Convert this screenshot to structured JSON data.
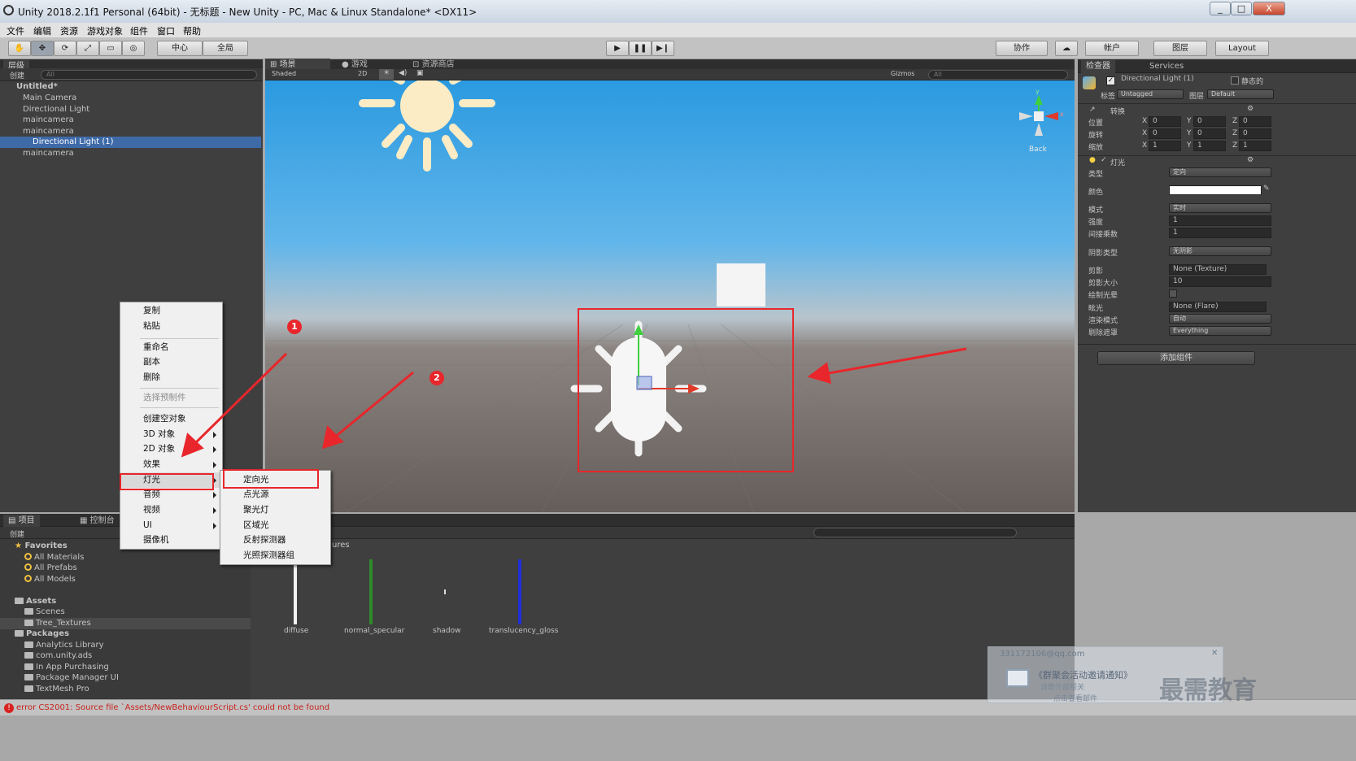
{
  "window": {
    "title": "Unity 2018.2.1f1 Personal (64bit) - 无标题 - New Unity - PC, Mac & Linux Standalone* <DX11>",
    "controls": [
      "_",
      "□",
      "X"
    ]
  },
  "menu": [
    "文件",
    "编辑",
    "资源",
    "游戏对象",
    "组件",
    "窗口",
    "帮助"
  ],
  "toolbar": {
    "pivot": "中心",
    "space": "全局",
    "collab": "协作",
    "account": "帐户",
    "layers": "图层",
    "layout": "Layout"
  },
  "hierarchy": {
    "tab": "层级",
    "create": "创建",
    "search_placeholder": "All",
    "scene_name": "Untitled*",
    "items": [
      "Main Camera",
      "Directional Light",
      "maincamera",
      "maincamera",
      "Directional Light (1)",
      "maincamera"
    ]
  },
  "scene_view": {
    "tabs": [
      "场景",
      "游戏",
      "资源商店"
    ],
    "shading": "Shaded",
    "mode_2d": "2D",
    "gizmos": "Gizmos",
    "search_placeholder": "All",
    "gizmo": {
      "y": "y",
      "x": "x",
      "back": "Back"
    }
  },
  "inspector": {
    "tabs": [
      "检查器",
      "Services"
    ],
    "object_name": "Directional Light (1)",
    "static_label": "静态的",
    "tag_label": "标签",
    "tag_value": "Untagged",
    "layer_label": "图层",
    "layer_value": "Default",
    "transform": {
      "title": "转换",
      "rows": [
        {
          "label": "位置",
          "x": "0",
          "y": "0",
          "z": "0"
        },
        {
          "label": "旋转",
          "x": "0",
          "y": "0",
          "z": "0"
        },
        {
          "label": "缩放",
          "x": "1",
          "y": "1",
          "z": "1"
        }
      ]
    },
    "light": {
      "title": "灯光",
      "type_label": "类型",
      "type_value": "定向",
      "color_label": "颜色",
      "mode_label": "模式",
      "mode_value": "实时",
      "intensity_label": "强度",
      "intensity_value": "1",
      "indirect_label": "间接乘数",
      "indirect_value": "1",
      "shadow_label": "阴影类型",
      "shadow_value": "无阴影",
      "cookie_label": "剪影",
      "cookie_value": "None (Texture)",
      "cookie_size_label": "剪影大小",
      "cookie_size_value": "10",
      "halo_label": "绘制光晕",
      "flare_label": "眩光",
      "flare_value": "None (Flare)",
      "render_mode_label": "渲染模式",
      "render_mode_value": "自动",
      "culling_label": "剔除遮罩",
      "culling_value": "Everything"
    },
    "add_component": "添加组件"
  },
  "project": {
    "tabs": [
      "项目",
      "控制台"
    ],
    "create": "创建",
    "favorites_title": "Favorites",
    "favorites": [
      "All Materials",
      "All Prefabs",
      "All Models"
    ],
    "assets_title": "Assets",
    "assets": [
      "Scenes",
      "Tree_Textures"
    ],
    "packages_title": "Packages",
    "packages": [
      "Analytics Library",
      "com.unity.ads",
      "In App Purchasing",
      "Package Manager UI",
      "TextMesh Pro"
    ],
    "path_fragment": "ures",
    "textures": [
      "diffuse",
      "normal_specular",
      "shadow",
      "translucency_gloss"
    ],
    "texture_colors": [
      "#f2f2f2",
      "#2f8a2a",
      "#dddddd",
      "#1f2fd9"
    ]
  },
  "context_menu": {
    "items": [
      "复制",
      "粘贴",
      "重命名",
      "副本",
      "删除",
      "选择预制件",
      "创建空对象",
      "3D 对象",
      "2D 对象",
      "效果",
      "灯光",
      "音频",
      "视频",
      "UI",
      "摄像机"
    ]
  },
  "submenu": {
    "items": [
      "定向光",
      "点光源",
      "聚光灯",
      "区域光",
      "反射探测器",
      "光照探测器组"
    ]
  },
  "annotations": {
    "badge1": "1",
    "badge2": "2"
  },
  "status": {
    "error": "error CS2001: Source file `Assets/NewBehaviourScript.cs' could not be found"
  },
  "notification": {
    "email": "331172106@qq.com",
    "title": "《群聚会活动邀请通知》",
    "line1": "请教外部帮关",
    "line2": "点击查看邮件"
  },
  "watermark": "最需教育"
}
